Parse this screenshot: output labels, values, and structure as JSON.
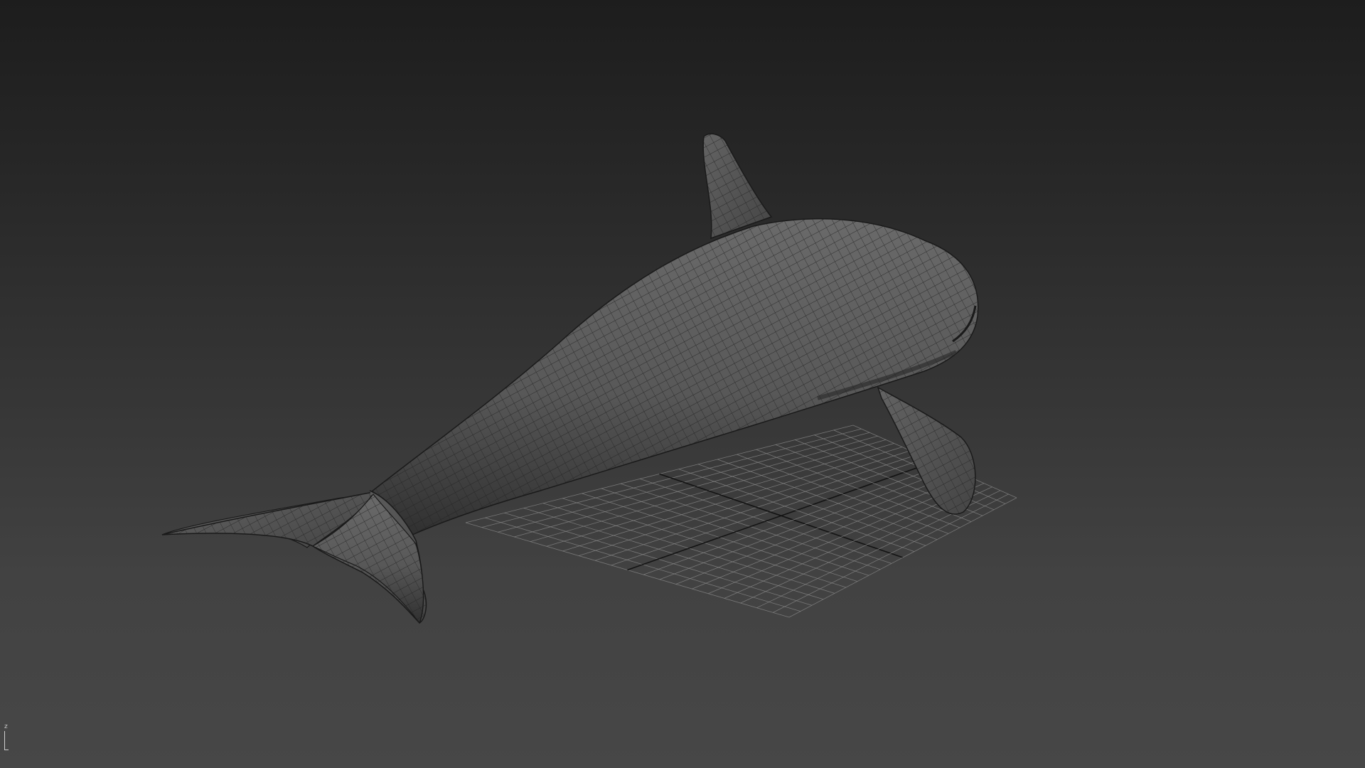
{
  "viewport": {
    "name": "perspective-viewport",
    "background_top": "#1d1d1d",
    "background_bottom": "#474747"
  },
  "model": {
    "name": "orca",
    "display": "wireframe-on-shaded",
    "surface_color": "#5a5a5a",
    "wire_color": "#222222"
  },
  "grid": {
    "line_color": "#8a8a8a",
    "axis_color": "#111111"
  },
  "axis_gizmo": {
    "label": "z",
    "color": "#cfcfcf"
  }
}
